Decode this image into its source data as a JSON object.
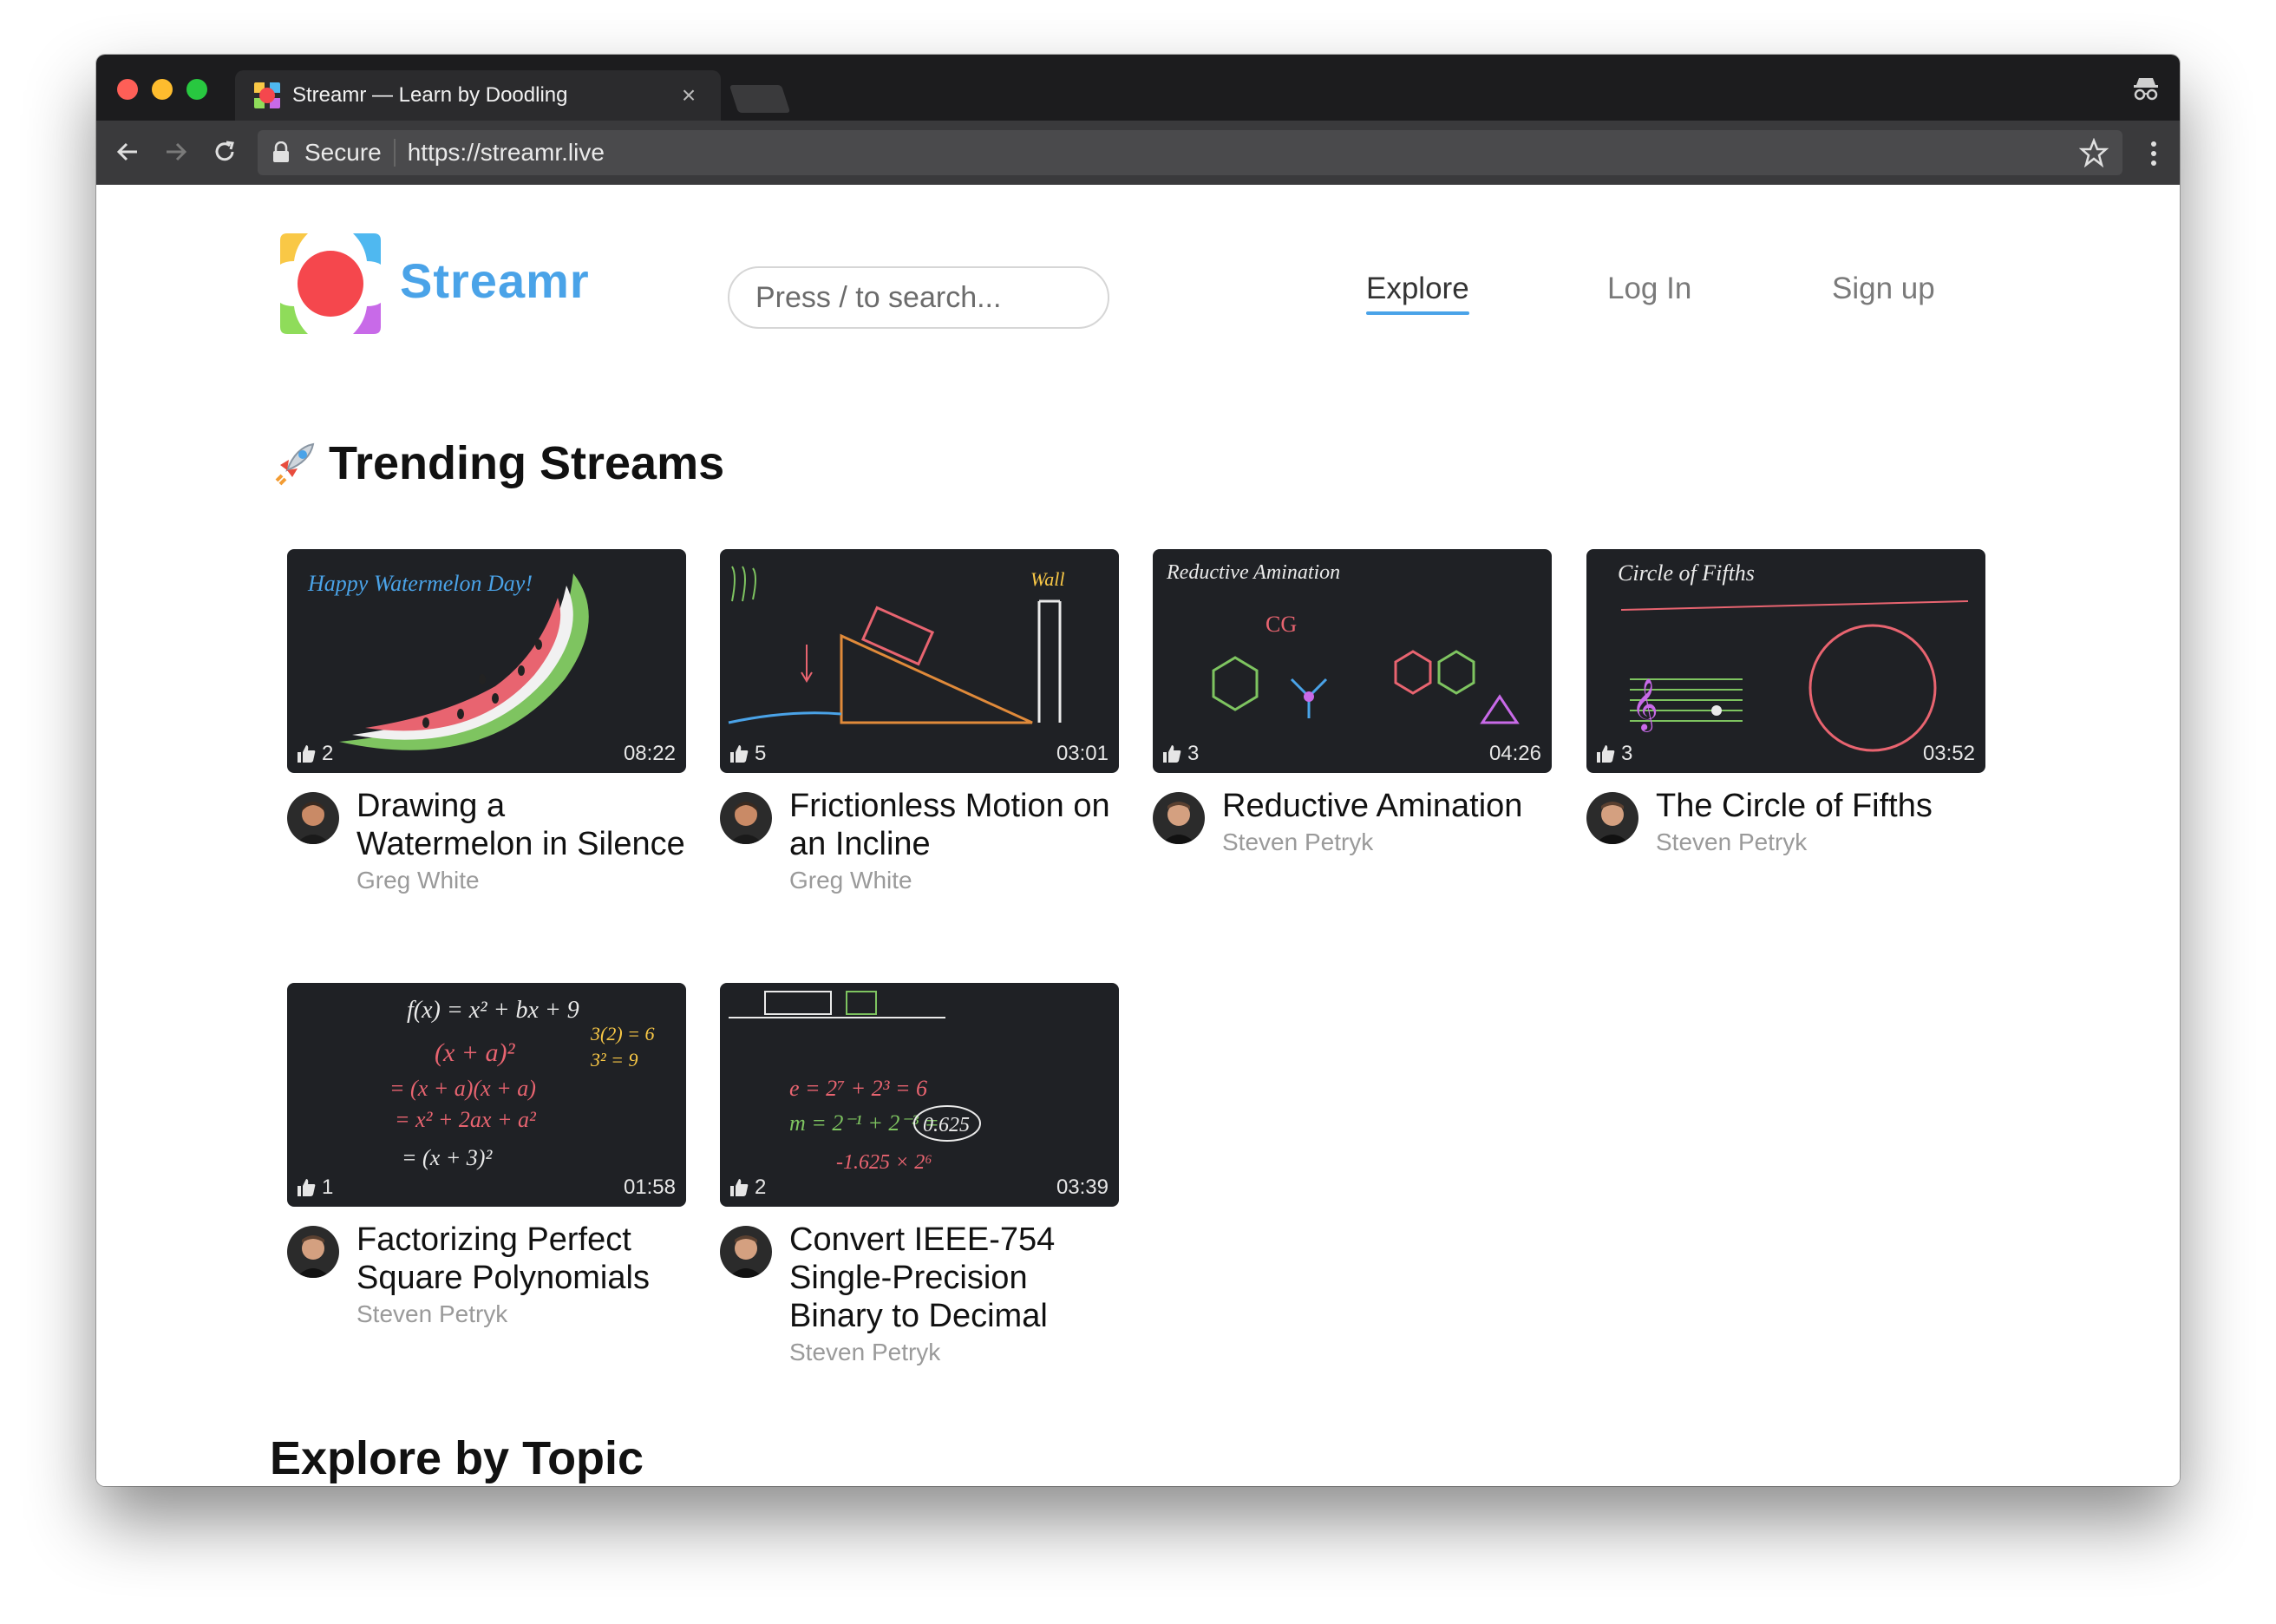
{
  "browser": {
    "tab_title": "Streamr — Learn by Doodling",
    "tab_close": "×",
    "secure_label": "Secure",
    "url": "https://streamr.live"
  },
  "header": {
    "brand": "Streamr",
    "search_placeholder": "Press / to search...",
    "nav": {
      "explore": "Explore",
      "login": "Log In",
      "signup": "Sign up"
    },
    "brand_color": "#4aa3e8"
  },
  "trending": {
    "title": "Trending Streams",
    "cards": [
      {
        "title": "Drawing a Watermelon in Silence",
        "author": "Greg White",
        "likes": "2",
        "duration": "08:22",
        "thumb_text": "Happy Watermelon Day!"
      },
      {
        "title": "Frictionless Motion on an Incline",
        "author": "Greg White",
        "likes": "5",
        "duration": "03:01",
        "thumb_text": "Wall"
      },
      {
        "title": "Reductive Amination",
        "author": "Steven Petryk",
        "likes": "3",
        "duration": "04:26",
        "thumb_text": "Reductive Amination"
      },
      {
        "title": "The Circle of Fifths",
        "author": "Steven Petryk",
        "likes": "3",
        "duration": "03:52",
        "thumb_text": "Circle of Fifths"
      },
      {
        "title": "Factorizing Perfect Square Polynomials",
        "author": "Steven Petryk",
        "likes": "1",
        "duration": "01:58",
        "thumb_text": "f(x) = x² + bx + 9"
      },
      {
        "title": "Convert IEEE-754 Single-Precision Binary to Decimal",
        "author": "Steven Petryk",
        "likes": "2",
        "duration": "03:39",
        "thumb_text": "0.625"
      }
    ]
  },
  "explore": {
    "title": "Explore by Topic"
  },
  "icons": {
    "logo": "streamr-logo-icon",
    "rocket": "rocket-icon",
    "like": "thumbs-up-icon",
    "lock": "lock-icon",
    "star": "star-icon",
    "incognito": "incognito-icon"
  }
}
